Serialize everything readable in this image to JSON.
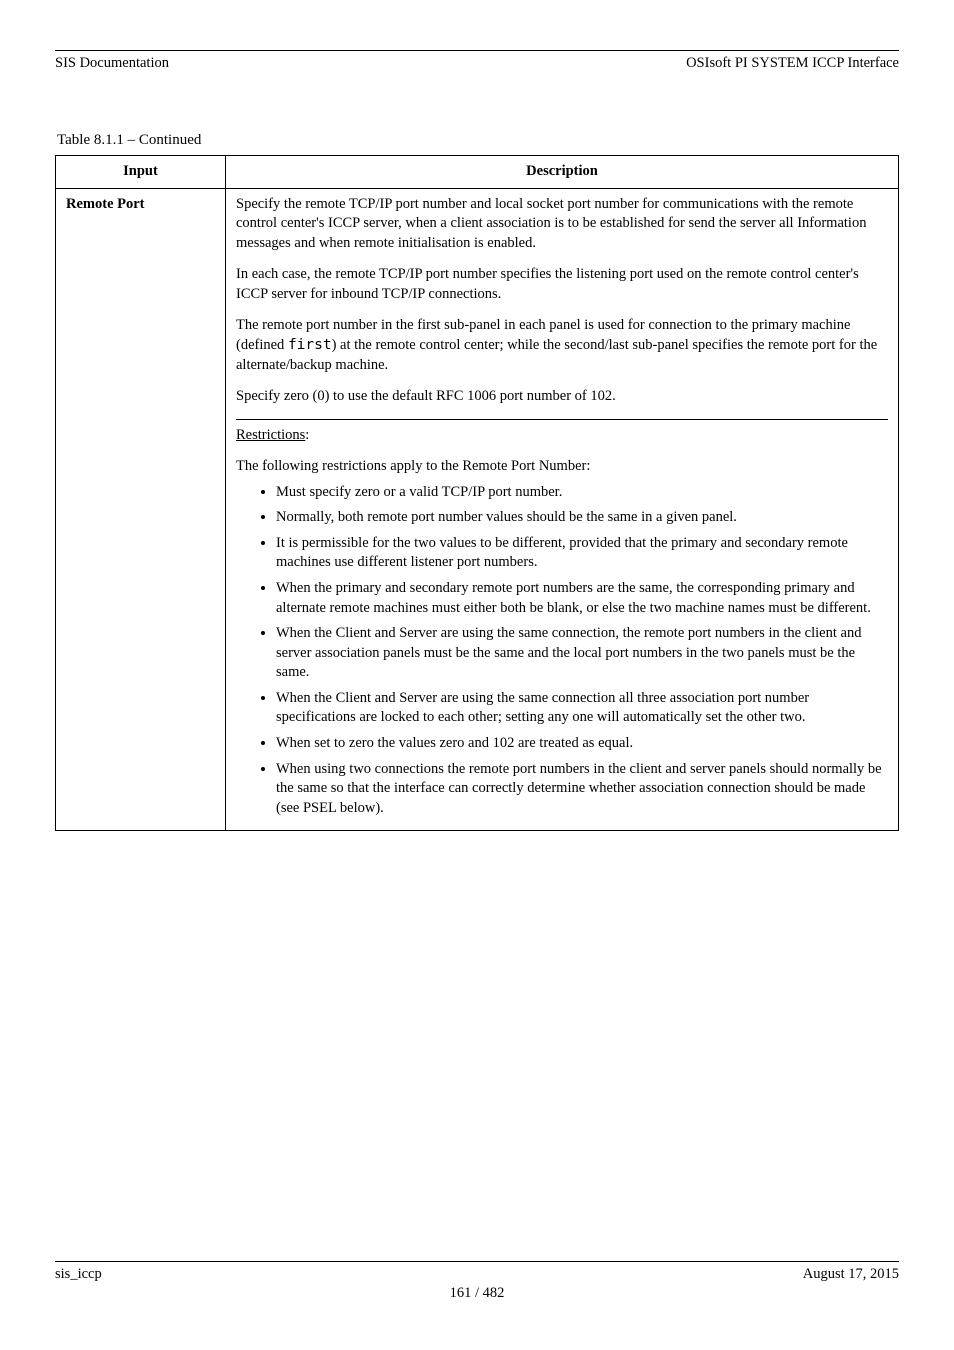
{
  "header": {
    "left": "SIS Documentation",
    "right": "OSIsoft PI SYSTEM ICCP Interface"
  },
  "table_title": "Table 8.1.1 – Continued",
  "columns": {
    "c1": "Input",
    "c2": "Description"
  },
  "row": {
    "label": "Remote Port",
    "p1": "Specify the remote TCP/IP port number and local socket port number for communications with the remote control center's ICCP server, when a client association is to be established for send the server all Information messages and when remote initialisation is enabled.",
    "p2": "In each case, the remote TCP/IP port number specifies the listening port used on the remote control center's ICCP server for inbound TCP/IP connections.",
    "p3_prefix": "The remote port number in the first sub-panel in each panel is used for connection to the primary machine (defined ",
    "p3_link": "first",
    "p3_suffix": ") at the remote control center; while the second/last sub-panel specifies the remote port for the alternate/backup machine.",
    "p4": "Specify zero (0) to use the default RFC 1006 port number of 102.",
    "p5_prefix": "",
    "p5_em": "Restrictions",
    "p5_suffix": ":",
    "p6": "The following restrictions apply to the Remote Port Number:",
    "bullets": [
      "Must specify zero or a valid TCP/IP port number.",
      "Normally, both remote port number values should be the same in a given panel.",
      "It is permissible for the two values to be different, provided that the primary and secondary remote machines use different listener port numbers.",
      "When the primary and secondary remote port numbers are the same, the corresponding primary and alternate remote machines must either both be blank, or else the two machine names must be different.",
      "When the Client and Server are using the same connection, the remote port numbers in the client and server association panels must be the same and the local port numbers in the two panels must be the same.",
      "When the Client and Server are using the same connection all three association port number specifications are locked to each other; setting any one will automatically set the other two.",
      "When set to zero the values zero and 102 are treated as equal.",
      "When using two connections the remote port numbers in the client and server panels should normally be the same so that the interface can correctly determine whether association connection should be made (see PSEL below)."
    ]
  },
  "footer": {
    "left": "sis_iccp",
    "right": "August 17, 2015",
    "page": "161 / 482"
  }
}
